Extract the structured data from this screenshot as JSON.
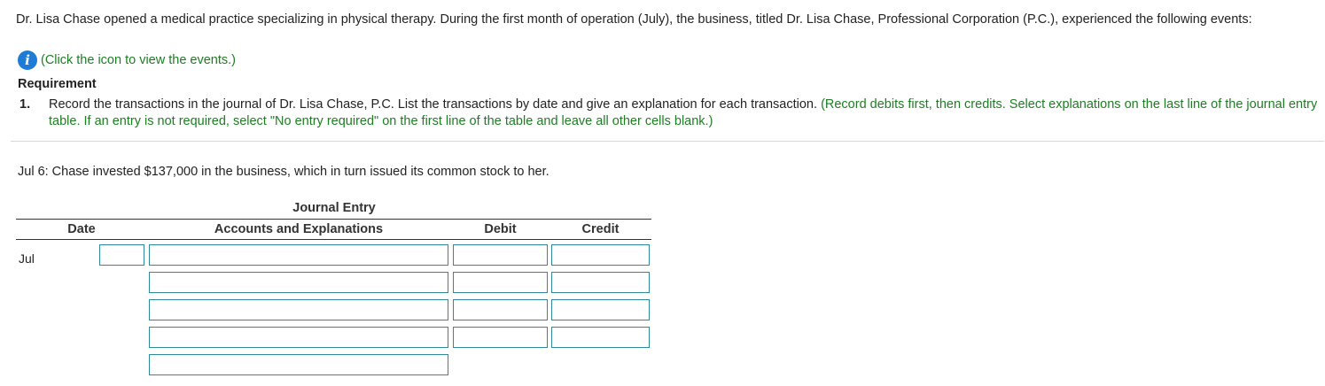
{
  "intro": {
    "text": "Dr. Lisa Chase opened a medical practice specializing in physical therapy. During the first month of operation (July), the business, titled Dr. Lisa Chase, Professional Corporation (P.C.), experienced the following events:"
  },
  "info": {
    "icon_glyph": "i",
    "icon": "info-icon",
    "link_text": "(Click the icon to view the events.)"
  },
  "requirement": {
    "heading": "Requirement",
    "number": "1.",
    "text": "Record the transactions in the journal of Dr. Lisa Chase, P.C. List the transactions by date and give an explanation for each transaction.",
    "instruction": "(Record debits first, then credits. Select explanations on the last line of the journal entry table. If an entry is not required, select \"No entry required\" on the first line of the table and leave all other cells blank.)"
  },
  "transaction": {
    "text": "Jul 6: Chase invested $137,000 in the business, which in turn issued its common stock to her."
  },
  "journal": {
    "title": "Journal Entry",
    "headers": {
      "date": "Date",
      "accounts": "Accounts and Explanations",
      "debit": "Debit",
      "credit": "Credit"
    },
    "month": "Jul",
    "rows": [
      {
        "date": "",
        "account": "",
        "debit": "",
        "credit": ""
      },
      {
        "account": "",
        "debit": "",
        "credit": ""
      },
      {
        "account": "",
        "debit": "",
        "credit": ""
      },
      {
        "account": "",
        "debit": "",
        "credit": ""
      },
      {
        "explanation": ""
      }
    ]
  },
  "colors": {
    "accent_green": "#1e7d23",
    "info_blue": "#1f7bd6",
    "input_border": "#2f8a9e"
  }
}
